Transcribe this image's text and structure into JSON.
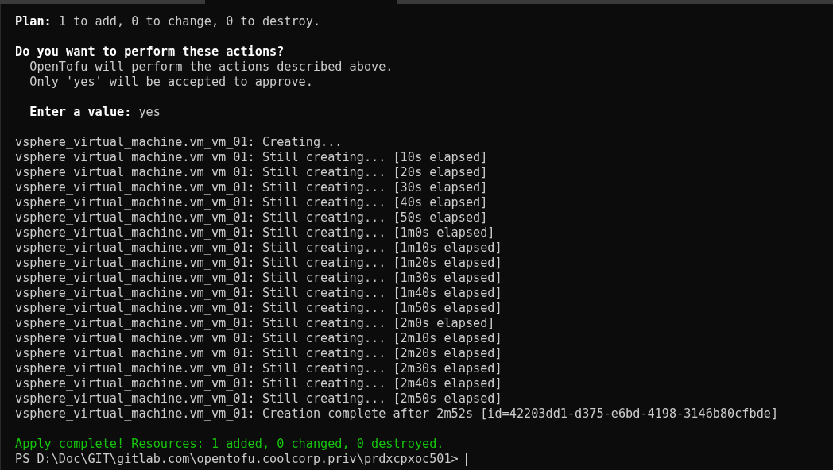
{
  "terminal": {
    "lines": [
      {
        "kind": "output",
        "text": "**Plan:** 1 to add, 0 to change, 0 to destroy."
      },
      {
        "kind": "blank"
      },
      {
        "kind": "output",
        "text": "**Do you want to perform these actions?**"
      },
      {
        "kind": "output",
        "text": "  OpenTofu will perform the actions described above."
      },
      {
        "kind": "output",
        "text": "  Only 'yes' will be accepted to approve."
      },
      {
        "kind": "blank"
      },
      {
        "kind": "output",
        "text": "  **Enter a value:** yes"
      },
      {
        "kind": "blank"
      },
      {
        "kind": "output",
        "text": "vsphere_virtual_machine.vm_vm_01: Creating..."
      },
      {
        "kind": "output",
        "text": "vsphere_virtual_machine.vm_vm_01: Still creating... [10s elapsed]"
      },
      {
        "kind": "output",
        "text": "vsphere_virtual_machine.vm_vm_01: Still creating... [20s elapsed]"
      },
      {
        "kind": "output",
        "text": "vsphere_virtual_machine.vm_vm_01: Still creating... [30s elapsed]"
      },
      {
        "kind": "output",
        "text": "vsphere_virtual_machine.vm_vm_01: Still creating... [40s elapsed]"
      },
      {
        "kind": "output",
        "text": "vsphere_virtual_machine.vm_vm_01: Still creating... [50s elapsed]"
      },
      {
        "kind": "output",
        "text": "vsphere_virtual_machine.vm_vm_01: Still creating... [1m0s elapsed]"
      },
      {
        "kind": "output",
        "text": "vsphere_virtual_machine.vm_vm_01: Still creating... [1m10s elapsed]"
      },
      {
        "kind": "output",
        "text": "vsphere_virtual_machine.vm_vm_01: Still creating... [1m20s elapsed]"
      },
      {
        "kind": "output",
        "text": "vsphere_virtual_machine.vm_vm_01: Still creating... [1m30s elapsed]"
      },
      {
        "kind": "output",
        "text": "vsphere_virtual_machine.vm_vm_01: Still creating... [1m40s elapsed]"
      },
      {
        "kind": "output",
        "text": "vsphere_virtual_machine.vm_vm_01: Still creating... [1m50s elapsed]"
      },
      {
        "kind": "output",
        "text": "vsphere_virtual_machine.vm_vm_01: Still creating... [2m0s elapsed]"
      },
      {
        "kind": "output",
        "text": "vsphere_virtual_machine.vm_vm_01: Still creating... [2m10s elapsed]"
      },
      {
        "kind": "output",
        "text": "vsphere_virtual_machine.vm_vm_01: Still creating... [2m20s elapsed]"
      },
      {
        "kind": "output",
        "text": "vsphere_virtual_machine.vm_vm_01: Still creating... [2m30s elapsed]"
      },
      {
        "kind": "output",
        "text": "vsphere_virtual_machine.vm_vm_01: Still creating... [2m40s elapsed]"
      },
      {
        "kind": "output",
        "text": "vsphere_virtual_machine.vm_vm_01: Still creating... [2m50s elapsed]"
      },
      {
        "kind": "output",
        "text": "vsphere_virtual_machine.vm_vm_01: Creation complete after 2m52s [id=42203dd1-d375-e6bd-4198-3146b80cfbde]"
      },
      {
        "kind": "blank"
      },
      {
        "kind": "success",
        "text": "Apply complete! Resources: 1 added, 0 changed, 0 destroyed."
      },
      {
        "kind": "prompt",
        "text": "PS D:\\Doc\\GIT\\gitlab.com\\opentofu.coolcorp.priv\\prdxcpxoc501> "
      }
    ]
  }
}
